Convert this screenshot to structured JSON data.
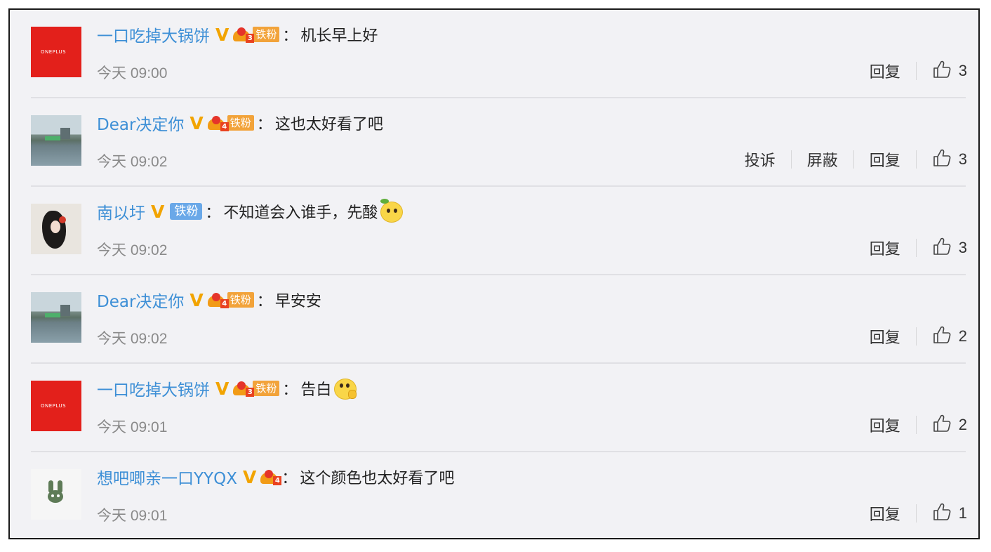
{
  "comments": [
    {
      "username": "一口吃掉大锅饼",
      "avatar": "oneplus-logo",
      "avatar_text": "ONEPLUS",
      "verified": "V",
      "fan_level": "3",
      "fan_badge": "铁粉",
      "fan_style": "orange",
      "text": "机长早上好",
      "emoji": "",
      "time": "今天 09:00",
      "actions": [
        "回复"
      ],
      "likes": "3"
    },
    {
      "username": "Dear决定你",
      "avatar": "lake-photo",
      "avatar_text": "",
      "verified": "V",
      "fan_level": "4",
      "fan_badge": "铁粉",
      "fan_style": "orange",
      "text": "这也太好看了吧",
      "emoji": "",
      "time": "今天 09:02",
      "actions": [
        "投诉",
        "屏蔽",
        "回复"
      ],
      "likes": "3"
    },
    {
      "username": "南以圩",
      "avatar": "woman-portrait",
      "avatar_text": "",
      "verified": "V",
      "fan_level": "",
      "fan_badge": "铁粉",
      "fan_style": "blue",
      "text": "不知道会入谁手，先酸",
      "emoji": "sour-lemon-emoji",
      "time": "今天 09:02",
      "actions": [
        "回复"
      ],
      "likes": "3"
    },
    {
      "username": "Dear决定你",
      "avatar": "lake-photo",
      "avatar_text": "",
      "verified": "V",
      "fan_level": "4",
      "fan_badge": "铁粉",
      "fan_style": "orange",
      "text": "早安安",
      "emoji": "",
      "time": "今天 09:02",
      "actions": [
        "回复"
      ],
      "likes": "2"
    },
    {
      "username": "一口吃掉大锅饼",
      "avatar": "oneplus-logo",
      "avatar_text": "ONEPLUS",
      "verified": "V",
      "fan_level": "3",
      "fan_badge": "铁粉",
      "fan_style": "orange",
      "text": "告白",
      "emoji": "shy-face-emoji",
      "time": "今天 09:01",
      "actions": [
        "回复"
      ],
      "likes": "2"
    },
    {
      "username": "想吧唧亲一口YYQX",
      "avatar": "bunny-logo",
      "avatar_text": "",
      "verified": "V",
      "fan_level": "4",
      "fan_badge": "",
      "fan_style": "none",
      "text": "这个颜色也太好看了吧",
      "emoji": "",
      "time": "今天 09:01",
      "actions": [
        "回复"
      ],
      "likes": "1"
    }
  ],
  "colon": "：",
  "icons": {
    "like": "thumbs-up-icon",
    "verified": "verified-v-icon",
    "crown": "fan-crown-icon"
  },
  "colors": {
    "username": "#3d8fd6",
    "verified": "#f2a400",
    "fan_orange": "#f2a33a",
    "fan_blue": "#6aa8e8",
    "background": "#f2f2f5"
  }
}
